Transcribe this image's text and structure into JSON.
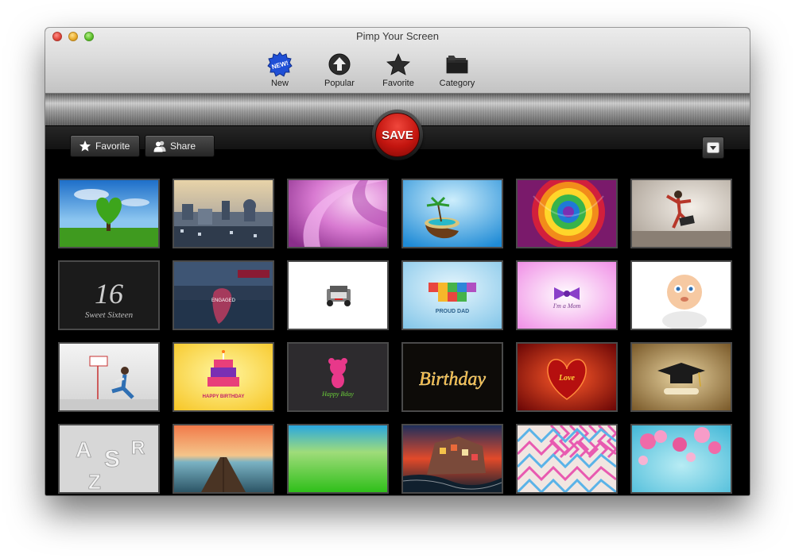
{
  "window": {
    "title": "Pimp Your Screen"
  },
  "toolbar": {
    "items": [
      {
        "label": "New",
        "badge": "NEW!"
      },
      {
        "label": "Popular"
      },
      {
        "label": "Favorite"
      },
      {
        "label": "Category"
      }
    ]
  },
  "actions": {
    "favorite_label": "Favorite",
    "share_label": "Share",
    "save_label": "SAVE"
  },
  "thumbnails": {
    "rows": [
      [
        {
          "subject": "green heart tree on meadow"
        },
        {
          "subject": "city rooftops"
        },
        {
          "subject": "pink swirl"
        },
        {
          "subject": "coconut island"
        },
        {
          "subject": "rainbow rose"
        },
        {
          "subject": "graffiti dancer"
        }
      ],
      [
        {
          "subject": "sweet sixteen",
          "text": "Sweet Sixteen"
        },
        {
          "subject": "engaged hands",
          "text": "ENGAGED"
        },
        {
          "subject": "toy jeep"
        },
        {
          "subject": "proud dad blocks",
          "text": "PROUD DAD"
        },
        {
          "subject": "pink bow",
          "text": "I'm a Mom"
        },
        {
          "subject": "cartoon baby"
        }
      ],
      [
        {
          "subject": "man sitting with sign"
        },
        {
          "subject": "birthday cake",
          "text": "HAPPY BIRTHDAY"
        },
        {
          "subject": "pink bear",
          "text": "Happy Bday"
        },
        {
          "subject": "sparkler lettering",
          "text": "Birthday"
        },
        {
          "subject": "red love heart",
          "text": "Love"
        },
        {
          "subject": "graduation cap"
        }
      ],
      [
        {
          "subject": "white 3d letters"
        },
        {
          "subject": "pier at sunset"
        },
        {
          "subject": "green gradient"
        },
        {
          "subject": "seaside village"
        },
        {
          "subject": "zigzag pattern"
        },
        {
          "subject": "pink blossoms"
        }
      ]
    ]
  },
  "colors": {
    "save_red": "#c3150f",
    "background": "#000000",
    "toolbar_gray": "#dcdcdc"
  }
}
